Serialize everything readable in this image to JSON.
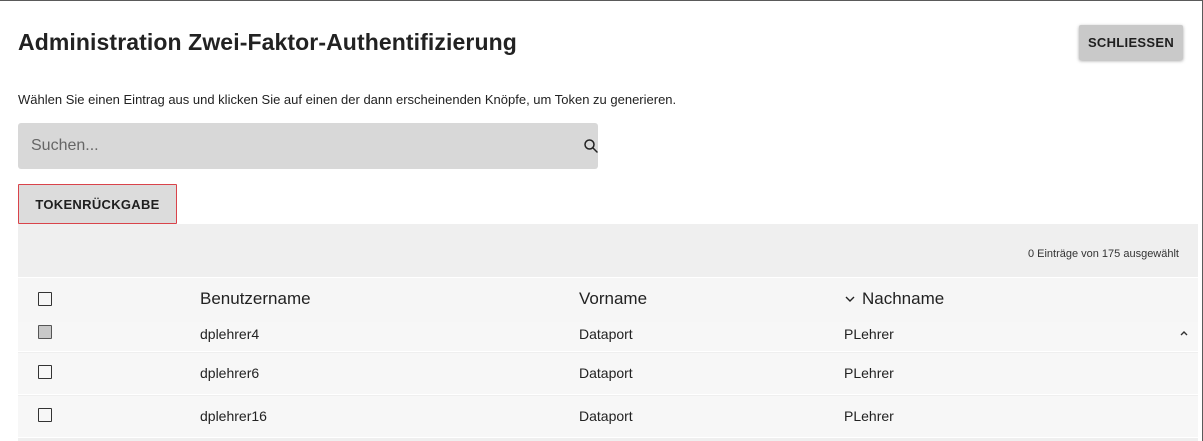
{
  "header": {
    "title": "Administration Zwei-Faktor-Authentifizierung",
    "close_label": "SCHLIESSEN"
  },
  "instructions": "Wählen Sie einen Eintrag aus und klicken Sie auf einen der dann erscheinenden Knöpfe, um Token zu generieren.",
  "search": {
    "placeholder": "Suchen...",
    "icon": "search-icon"
  },
  "actions": {
    "token_return_label": "TOKENRÜCKGABE"
  },
  "table": {
    "selection_summary": "0 Einträge von 175 ausgewählt",
    "columns": {
      "username": "Benutzername",
      "first_name": "Vorname",
      "last_name": "Nachname",
      "sort_icon": "chevron-down-icon"
    },
    "rows": [
      {
        "username": "dplehrer4",
        "first_name": "Dataport",
        "last_name": "PLehrer"
      },
      {
        "username": "dplehrer6",
        "first_name": "Dataport",
        "last_name": "PLehrer"
      },
      {
        "username": "dplehrer16",
        "first_name": "Dataport",
        "last_name": "PLehrer"
      }
    ],
    "scroll_icon": "chevron-up-icon"
  },
  "colors": {
    "close_button_bg": "#c9c9c9",
    "search_bg": "#d8d8d8",
    "token_button_border": "#d9434a",
    "table_bg": "#efefef"
  }
}
